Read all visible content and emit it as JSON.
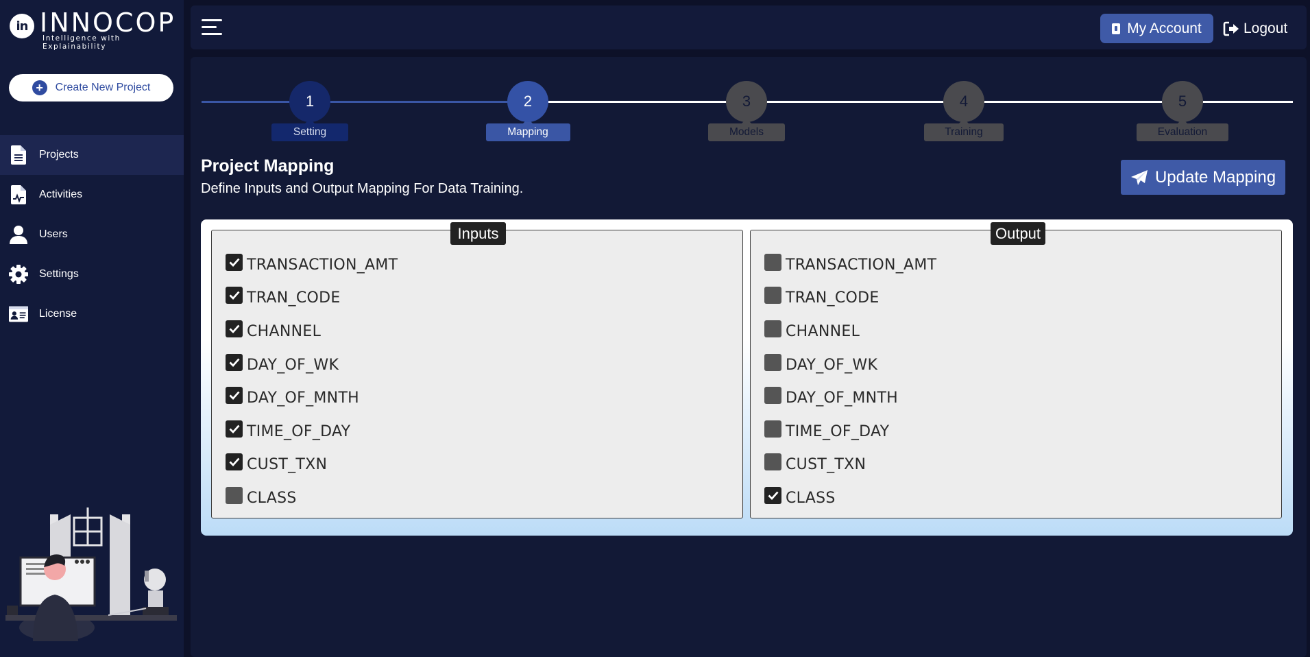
{
  "brand": {
    "mark": "in",
    "name": "INNOCOP",
    "tagline": "Intelligence with Explainability"
  },
  "sidebar": {
    "create_button": "Create New Project",
    "items": [
      {
        "label": "Projects",
        "icon": "document-icon",
        "active": true
      },
      {
        "label": "Activities",
        "icon": "activity-file-icon",
        "active": false
      },
      {
        "label": "Users",
        "icon": "user-icon",
        "active": false
      },
      {
        "label": "Settings",
        "icon": "gear-icon",
        "active": false
      },
      {
        "label": "License",
        "icon": "id-card-icon",
        "active": false
      }
    ]
  },
  "header": {
    "account_label": "My Account",
    "logout_label": "Logout"
  },
  "stepper": {
    "steps": [
      {
        "number": "1",
        "label": "Setting",
        "state": "done"
      },
      {
        "number": "2",
        "label": "Mapping",
        "state": "active"
      },
      {
        "number": "3",
        "label": "Models",
        "state": "todo"
      },
      {
        "number": "4",
        "label": "Training",
        "state": "todo"
      },
      {
        "number": "5",
        "label": "Evaluation",
        "state": "todo"
      }
    ]
  },
  "page": {
    "title": "Project Mapping",
    "subtitle": "Define Inputs and Output Mapping For Data Training.",
    "update_button": "Update Mapping"
  },
  "mapping": {
    "inputs": {
      "legend": "Inputs",
      "fields": [
        {
          "name": "TRANSACTION_AMT",
          "checked": true
        },
        {
          "name": "TRAN_CODE",
          "checked": true
        },
        {
          "name": "CHANNEL",
          "checked": true
        },
        {
          "name": "DAY_OF_WK",
          "checked": true
        },
        {
          "name": "DAY_OF_MNTH",
          "checked": true
        },
        {
          "name": "TIME_OF_DAY",
          "checked": true
        },
        {
          "name": "CUST_TXN",
          "checked": true
        },
        {
          "name": "CLASS",
          "checked": false
        }
      ]
    },
    "output": {
      "legend": "Output",
      "fields": [
        {
          "name": "TRANSACTION_AMT",
          "checked": false
        },
        {
          "name": "TRAN_CODE",
          "checked": false
        },
        {
          "name": "CHANNEL",
          "checked": false
        },
        {
          "name": "DAY_OF_WK",
          "checked": false
        },
        {
          "name": "DAY_OF_MNTH",
          "checked": false
        },
        {
          "name": "TIME_OF_DAY",
          "checked": false
        },
        {
          "name": "CUST_TXN",
          "checked": false
        },
        {
          "name": "CLASS",
          "checked": true
        }
      ]
    }
  },
  "colors": {
    "background": "#0d1128",
    "sidebar": "#121a3a",
    "accent": "#3f5aa7",
    "step_done": "#15286a",
    "step_todo": "#4a4a4e"
  }
}
